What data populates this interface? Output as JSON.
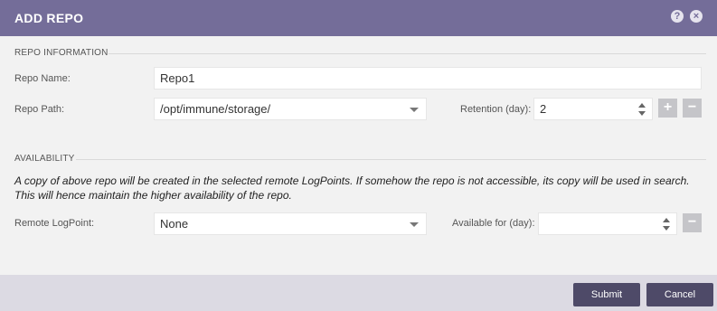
{
  "dialog": {
    "title": "ADD REPO",
    "help_icon": "question-icon",
    "close_icon": "close-icon"
  },
  "repo_information": {
    "section_title": "REPO INFORMATION",
    "repo_name_label": "Repo Name:",
    "repo_name_value": "Repo1",
    "repo_path_label": "Repo Path:",
    "repo_path_value": "/opt/immune/storage/",
    "retention_label": "Retention (day):",
    "retention_value": "2",
    "add_symbol": "+",
    "remove_symbol": "−"
  },
  "availability": {
    "section_title": "AVAILABILITY",
    "notice": "A copy of above repo will be created in the selected remote LogPoints. If somehow the repo is not accessible, its copy will be used in search. This will hence maintain the higher availability of the repo.",
    "remote_logpoint_label": "Remote LogPoint:",
    "remote_logpoint_value": "None",
    "available_for_label": "Available for (day):",
    "available_for_value": "",
    "remove_symbol": "−"
  },
  "footer": {
    "submit_label": "Submit",
    "cancel_label": "Cancel"
  },
  "colors": {
    "titlebar": "#746d99",
    "footer": "#dcdae3",
    "button": "#4e4a68",
    "body_bg": "#f2f2f2",
    "square_button": "#c5c5c9"
  }
}
